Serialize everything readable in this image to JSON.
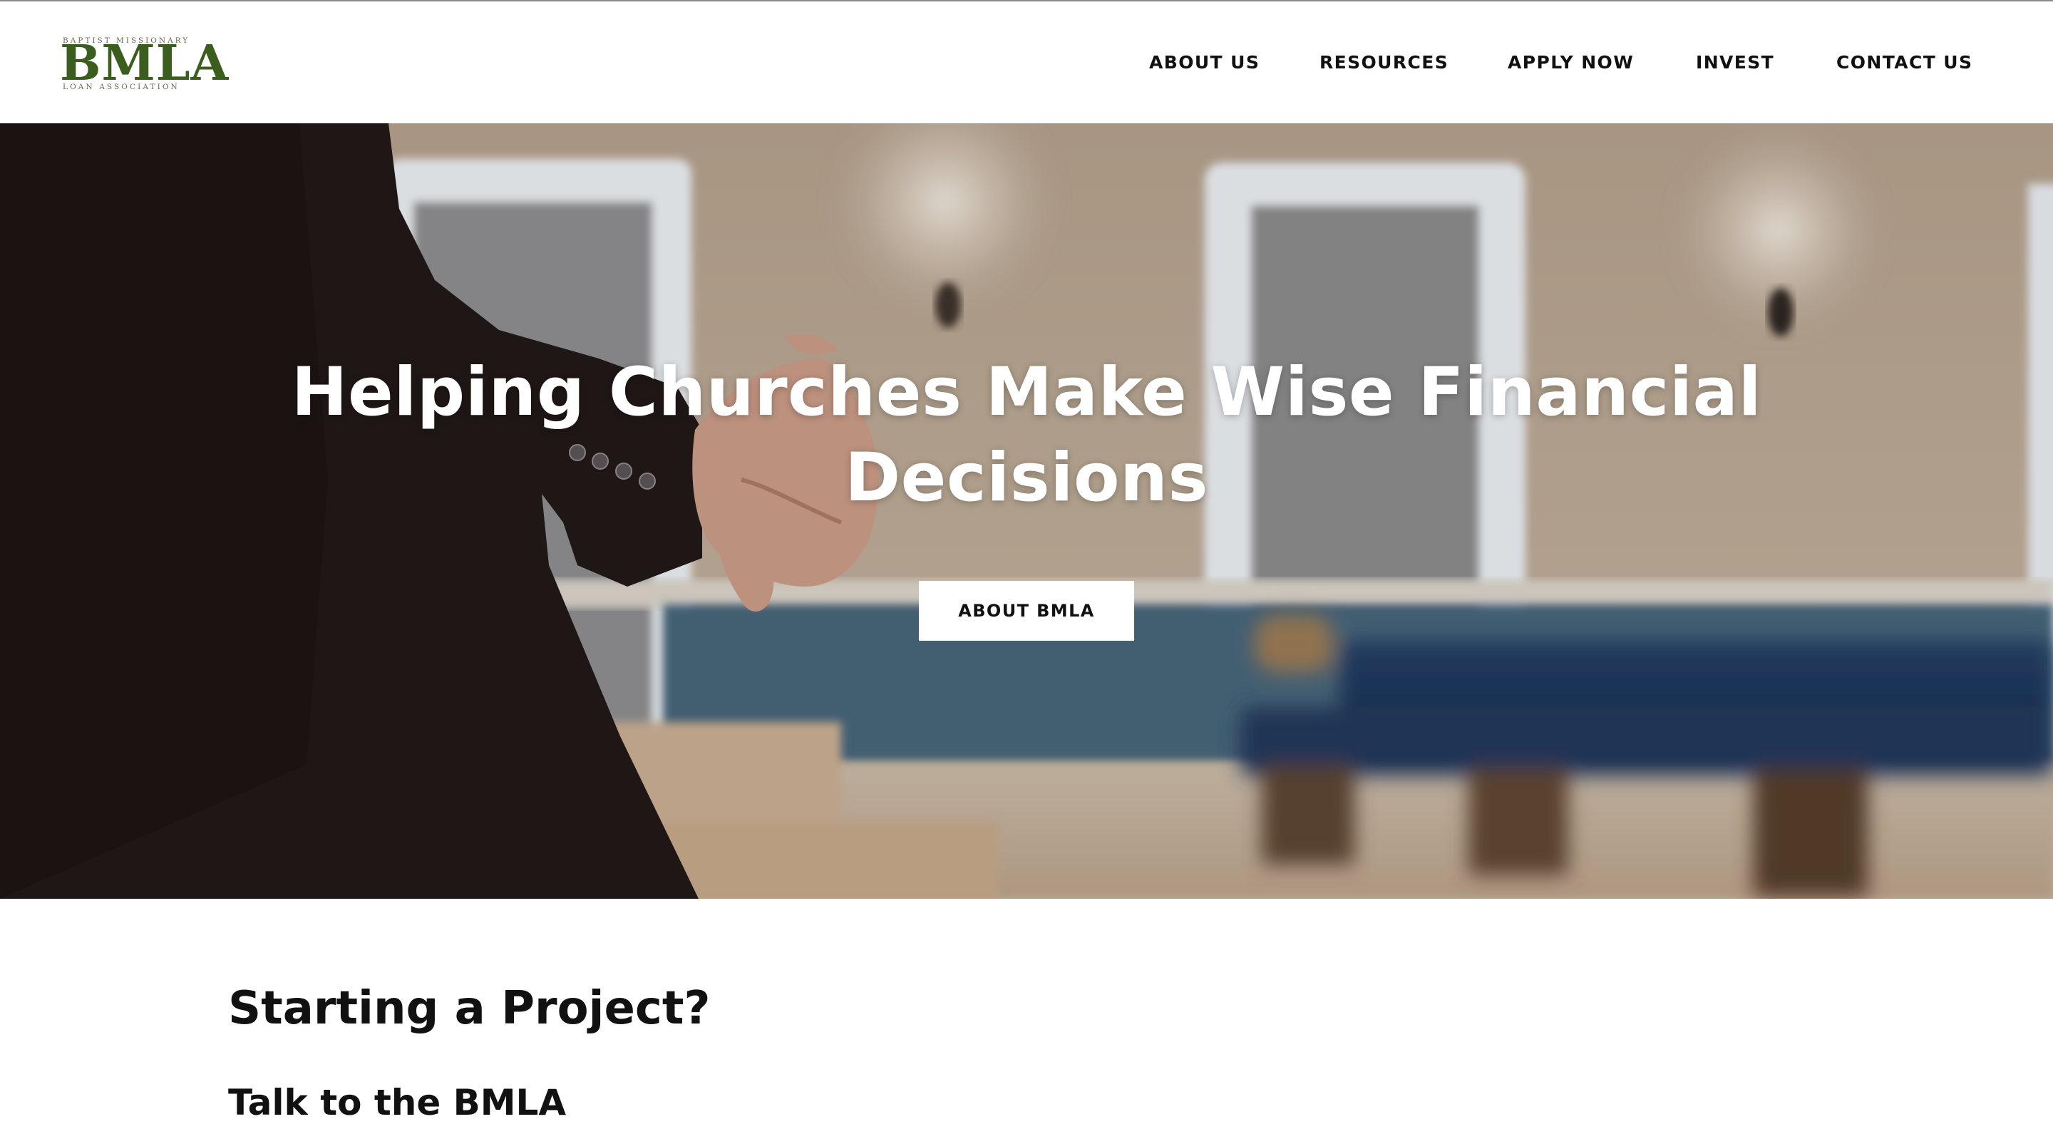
{
  "logo": {
    "top_text": "BAPTIST MISSIONARY",
    "main_text": "BMLA",
    "bottom_text": "LOAN ASSOCIATION",
    "color": "#3b5e1e"
  },
  "nav": {
    "items": [
      {
        "label": "ABOUT US"
      },
      {
        "label": "RESOURCES"
      },
      {
        "label": "APPLY NOW"
      },
      {
        "label": "INVEST"
      },
      {
        "label": "CONTACT US"
      }
    ]
  },
  "hero": {
    "title_line1": "Helping Churches Make Wise Financial",
    "title_line2": "Decisions",
    "button_label": "ABOUT BMLA"
  },
  "content": {
    "heading": "Starting a Project?",
    "subheading": "Talk to the BMLA"
  }
}
